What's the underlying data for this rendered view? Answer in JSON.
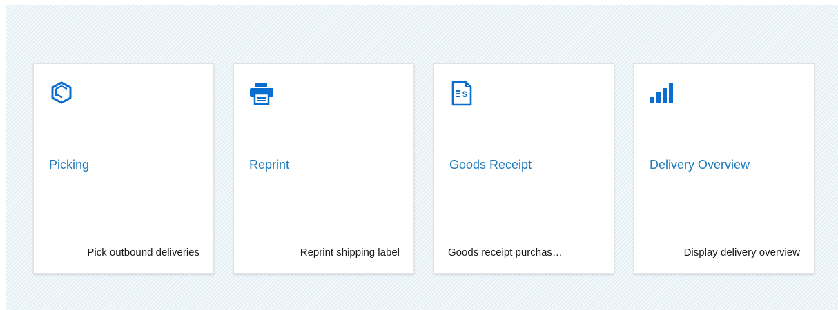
{
  "tiles": [
    {
      "title": "Picking",
      "subtitle": "Pick outbound deliveries",
      "icon": "package-icon"
    },
    {
      "title": "Reprint",
      "subtitle": "Reprint shipping label",
      "icon": "printer-icon"
    },
    {
      "title": "Goods Receipt",
      "subtitle": "Goods receipt purchas…",
      "icon": "invoice-document-icon"
    },
    {
      "title": "Delivery Overview",
      "subtitle": "Display delivery overview",
      "icon": "bar-chart-icon"
    }
  ],
  "colors": {
    "accent": "#1f7bbd",
    "icon": "#0a6ed1",
    "text": "#1a1a1a"
  }
}
